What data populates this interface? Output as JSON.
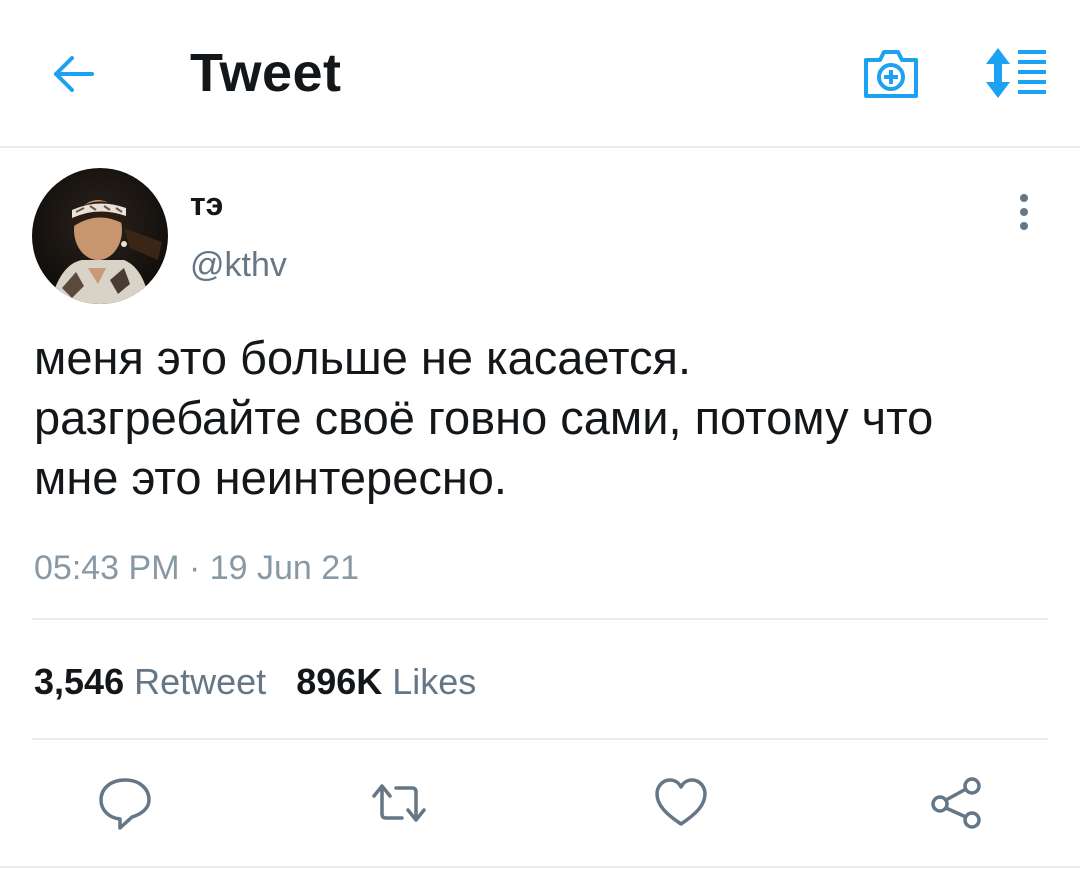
{
  "header": {
    "title": "Tweet",
    "back_icon": "arrow-left-icon",
    "camera_icon": "camera-plus-icon",
    "sort_icon": "sort-list-icon",
    "accent_color": "#1da1f2"
  },
  "tweet": {
    "author": {
      "display_name": "тэ",
      "handle": "@kthv",
      "avatar_icon": "profile-photo"
    },
    "text_lines": [
      "меня это больше не касается.",
      "разгребайте своё говно сами, потому что",
      "мне это неинтересно."
    ],
    "timestamp": "05:43 PM · 19 Jun 21",
    "stats": {
      "retweet_count": "3,546",
      "retweet_label": "Retweet",
      "like_count": "896K",
      "like_label": "Likes"
    }
  },
  "actions": [
    {
      "name": "reply",
      "icon": "comment-icon"
    },
    {
      "name": "retweet",
      "icon": "retweet-icon"
    },
    {
      "name": "like",
      "icon": "heart-icon"
    },
    {
      "name": "share",
      "icon": "share-icon"
    }
  ]
}
